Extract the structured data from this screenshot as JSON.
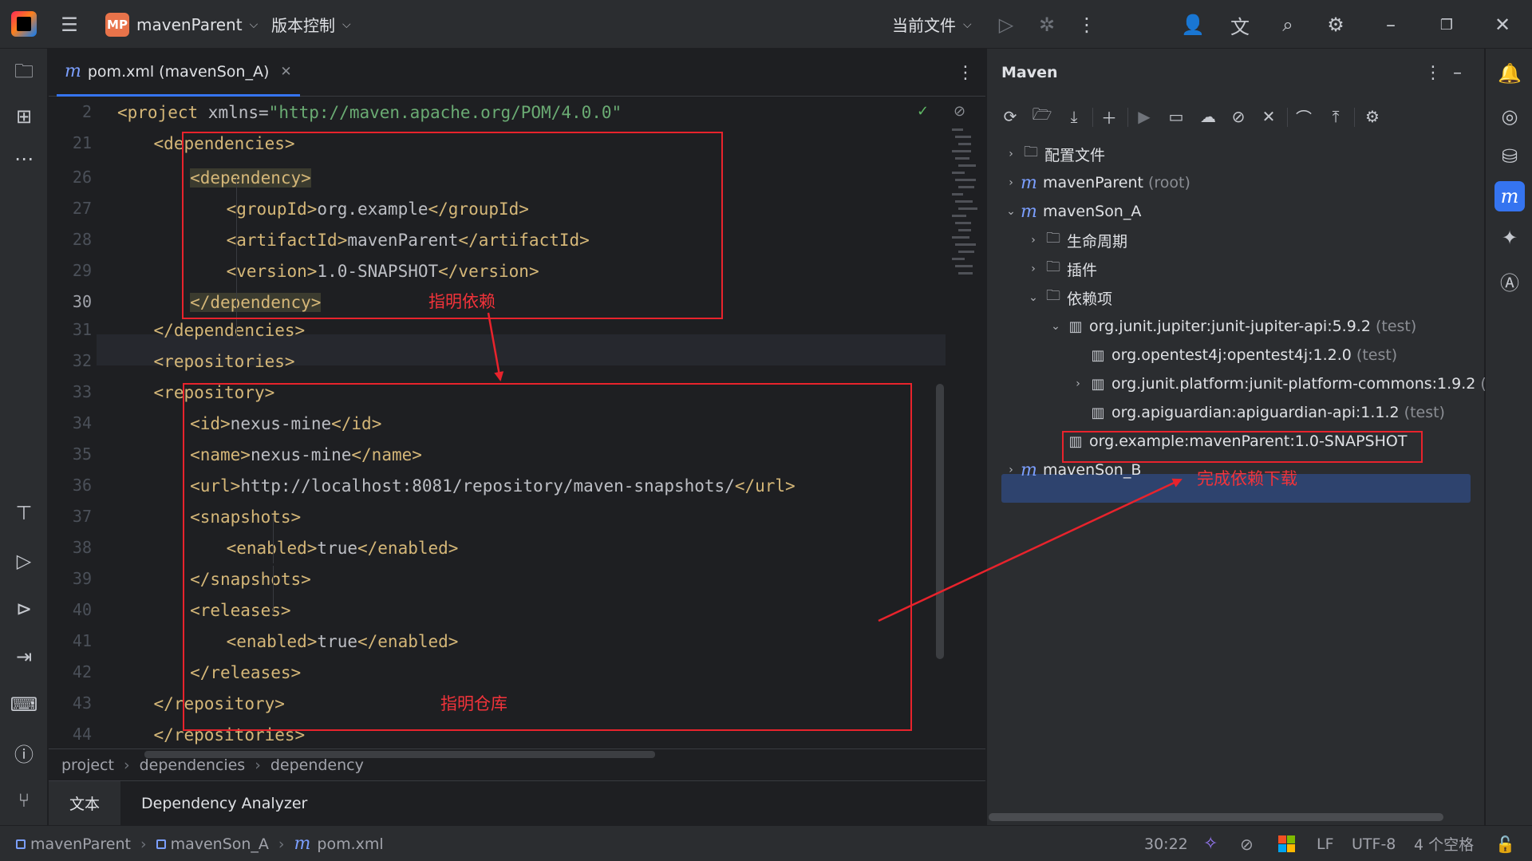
{
  "titlebar": {
    "project_badge": "MP",
    "project_name": "mavenParent",
    "vcs_label": "版本控制",
    "run_config": "当前文件"
  },
  "editor": {
    "tab_label": "pom.xml (mavenSon_A)",
    "tab_icon": "m",
    "current_line": 30,
    "lines": [
      {
        "no": "2",
        "text": "<project xmlns=\"http://maven.apache.org/POM/4.0.0\""
      },
      {
        "no": "21",
        "text": "<dependencies>"
      },
      {
        "no": "26",
        "text": "<dependency>"
      },
      {
        "no": "27",
        "text": "<groupId>org.example</groupId>"
      },
      {
        "no": "28",
        "text": "<artifactId>mavenParent</artifactId>"
      },
      {
        "no": "29",
        "text": "<version>1.0-SNAPSHOT</version>"
      },
      {
        "no": "30",
        "text": "</dependency>"
      },
      {
        "no": "31",
        "text": "</dependencies>"
      },
      {
        "no": "32",
        "text": "<repositories>"
      },
      {
        "no": "33",
        "text": "<repository>"
      },
      {
        "no": "34",
        "text": "<id>nexus-mine</id>"
      },
      {
        "no": "35",
        "text": "<name>nexus-mine</name>"
      },
      {
        "no": "36",
        "text": "<url>http://localhost:8081/repository/maven-snapshots/</url>"
      },
      {
        "no": "37",
        "text": "<snapshots>"
      },
      {
        "no": "38",
        "text": "<enabled>true</enabled>"
      },
      {
        "no": "39",
        "text": "</snapshots>"
      },
      {
        "no": "40",
        "text": "<releases>"
      },
      {
        "no": "41",
        "text": "<enabled>true</enabled>"
      },
      {
        "no": "42",
        "text": "</releases>"
      },
      {
        "no": "43",
        "text": "</repository>"
      },
      {
        "no": "44",
        "text": "</repositories>"
      }
    ],
    "breadcrumb": [
      "project",
      "dependencies",
      "dependency"
    ],
    "bottom_tabs": [
      "文本",
      "Dependency Analyzer"
    ]
  },
  "maven": {
    "title": "Maven",
    "tree": [
      {
        "label": "配置文件",
        "suffix": ""
      },
      {
        "label": "mavenParent",
        "suffix": "(root)"
      },
      {
        "label": "mavenSon_A",
        "suffix": ""
      },
      {
        "label": "生命周期",
        "suffix": ""
      },
      {
        "label": "插件",
        "suffix": ""
      },
      {
        "label": "依赖项",
        "suffix": ""
      },
      {
        "label": "org.junit.jupiter:junit-jupiter-api:5.9.2",
        "suffix": "(test)"
      },
      {
        "label": "org.opentest4j:opentest4j:1.2.0",
        "suffix": "(test)"
      },
      {
        "label": "org.junit.platform:junit-platform-commons:1.9.2",
        "suffix": "(t"
      },
      {
        "label": "org.apiguardian:apiguardian-api:1.1.2",
        "suffix": "(test)"
      },
      {
        "label": "org.example:mavenParent:1.0-SNAPSHOT",
        "suffix": ""
      },
      {
        "label": "mavenSon_B",
        "suffix": ""
      }
    ]
  },
  "statusbar": {
    "path": [
      "mavenParent",
      "mavenSon_A",
      "pom.xml"
    ],
    "position": "30:22",
    "line_sep": "LF",
    "encoding": "UTF-8",
    "indent": "4 个空格"
  },
  "annotations": {
    "dependency_note": "指明依赖",
    "repository_note": "指明仓库",
    "download_note": "完成依赖下载"
  },
  "colors": {
    "accent": "#3574f0",
    "annotation": "#e8232c",
    "tag": "#d5b778",
    "string": "#6aab73"
  }
}
